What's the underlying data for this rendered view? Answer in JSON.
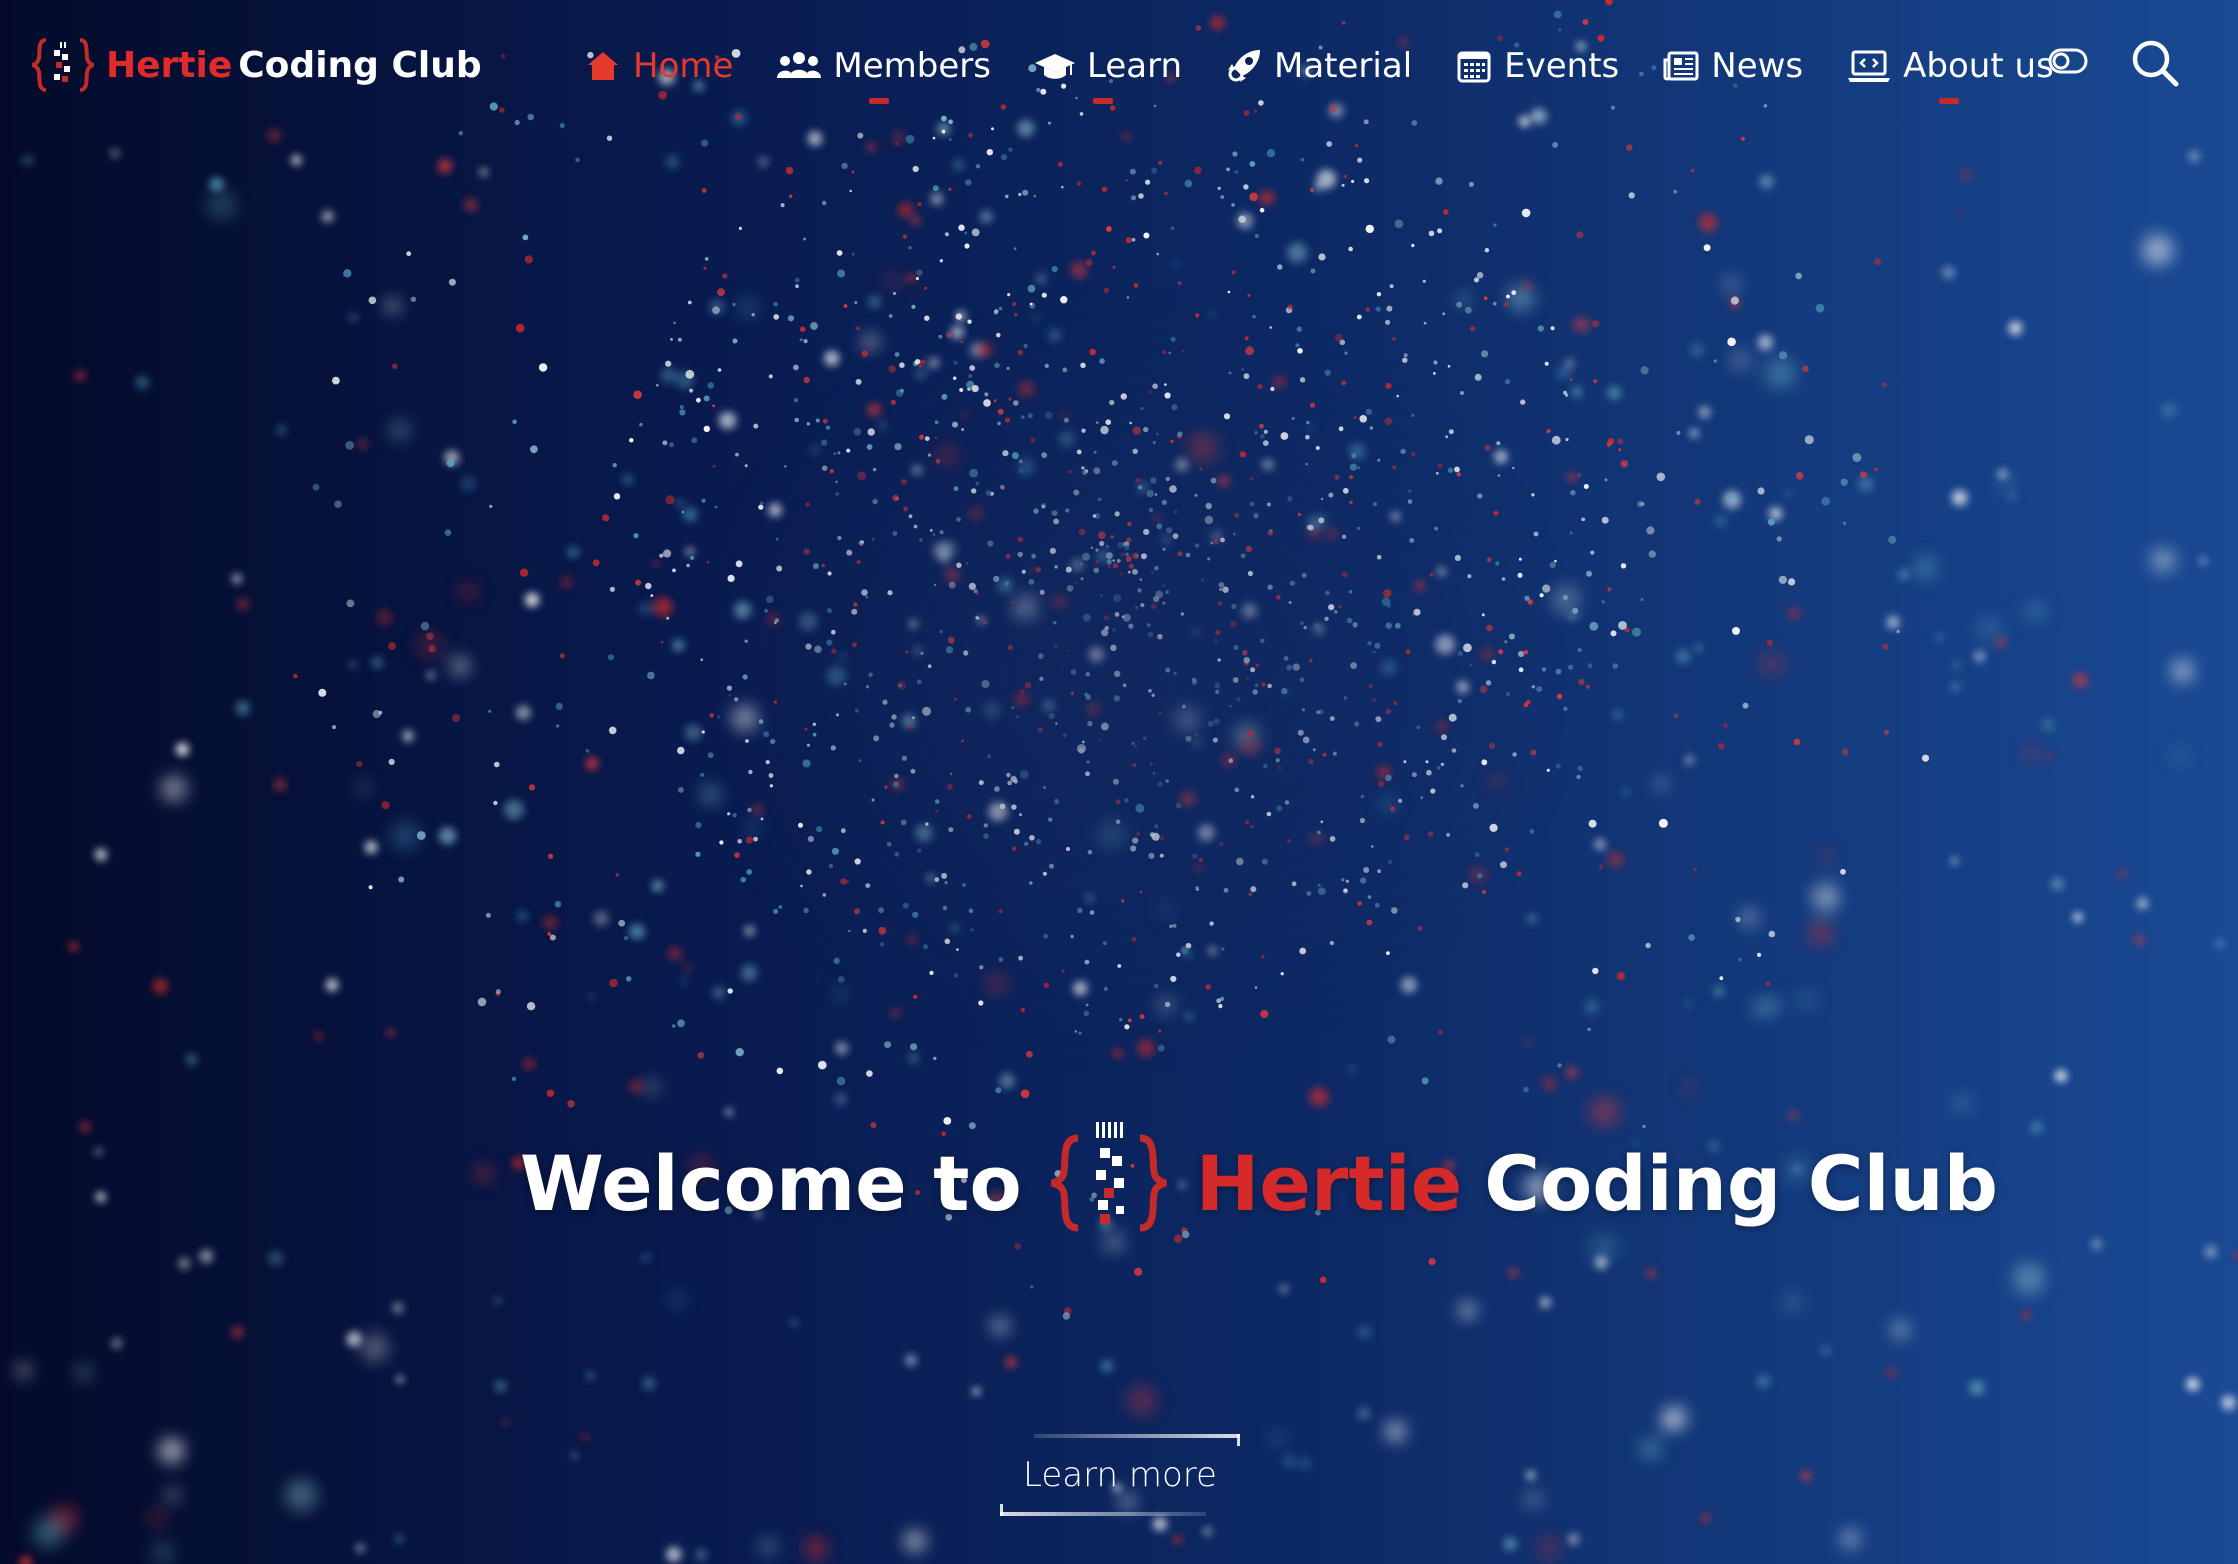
{
  "brand": {
    "name_red": "Hertie",
    "name_white": "Coding Club"
  },
  "nav": {
    "items": [
      {
        "label": "Home",
        "icon": "home-icon",
        "active": true
      },
      {
        "label": "Members",
        "icon": "users-icon",
        "active": false
      },
      {
        "label": "Learn",
        "icon": "graduation-cap-icon",
        "active": false
      },
      {
        "label": "Material",
        "icon": "rocket-icon",
        "active": false
      },
      {
        "label": "Events",
        "icon": "calendar-icon",
        "active": false
      },
      {
        "label": "News",
        "icon": "newspaper-icon",
        "active": false
      },
      {
        "label": "About us",
        "icon": "laptop-code-icon",
        "active": false
      }
    ]
  },
  "hero": {
    "prefix": "Welcome to",
    "name_red": "Hertie",
    "name_white": "Coding Club",
    "cta_label": "Learn more"
  },
  "colors": {
    "accent_red": "#e02b2b",
    "background_dark": "#040b2a",
    "background_light": "#1a4a94"
  }
}
